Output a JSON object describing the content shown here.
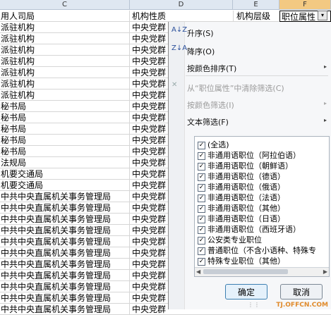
{
  "columns": [
    {
      "id": "C",
      "label": "C"
    },
    {
      "id": "D",
      "label": "D"
    },
    {
      "id": "E",
      "label": "E"
    },
    {
      "id": "F",
      "label": "F"
    }
  ],
  "header_row": {
    "c": "用人司局",
    "d": "机构性质",
    "e": "机构层级",
    "f": "职位属性",
    "dropdown_glyph": "▾"
  },
  "rows": [
    {
      "c": "派驻机构",
      "d": "中央党群"
    },
    {
      "c": "派驻机构",
      "d": "中央党群"
    },
    {
      "c": "派驻机构",
      "d": "中央党群"
    },
    {
      "c": "派驻机构",
      "d": "中央党群"
    },
    {
      "c": "派驻机构",
      "d": "中央党群"
    },
    {
      "c": "派驻机构",
      "d": "中央党群"
    },
    {
      "c": "派驻机构",
      "d": "中央党群"
    },
    {
      "c": "秘书局",
      "d": "中央党群"
    },
    {
      "c": "秘书局",
      "d": "中央党群"
    },
    {
      "c": "秘书局",
      "d": "中央党群"
    },
    {
      "c": "秘书局",
      "d": "中央党群"
    },
    {
      "c": "秘书局",
      "d": "中央党群"
    },
    {
      "c": "法规局",
      "d": "中央党群"
    },
    {
      "c": "机要交通局",
      "d": "中央党群"
    },
    {
      "c": "机要交通局",
      "d": "中央党群"
    },
    {
      "c": "中共中央直属机关事务管理局",
      "d": "中央党群"
    },
    {
      "c": "中共中央直属机关事务管理局",
      "d": "中央党群"
    },
    {
      "c": "中共中央直属机关事务管理局",
      "d": "中央党群"
    },
    {
      "c": "中共中央直属机关事务管理局",
      "d": "中央党群"
    },
    {
      "c": "中共中央直属机关事务管理局",
      "d": "中央党群"
    },
    {
      "c": "中共中央直属机关事务管理局",
      "d": "中央党群"
    },
    {
      "c": "中共中央直属机关事务管理局",
      "d": "中央党群"
    },
    {
      "c": "中共中央直属机关事务管理局",
      "d": "中央党群"
    },
    {
      "c": "中共中央直属机关事务管理局",
      "d": "中央党群"
    },
    {
      "c": "中共中央直属机关事务管理局",
      "d": "中央党群"
    },
    {
      "c": "中共中央直属机关事务管理局",
      "d": "中央党群"
    }
  ],
  "menu": {
    "sort_asc": "升序(S)",
    "sort_desc": "降序(O)",
    "sort_by_color": "按颜色排序(T)",
    "clear_filter": "从“职位属性”中清除筛选(C)",
    "filter_by_color": "按颜色筛选(I)",
    "text_filter": "文本筛选(F)",
    "sort_asc_icon": "A↓Z",
    "sort_desc_icon": "Z↓A",
    "clear_icon": "✕",
    "submenu_arrow": "▸",
    "options": [
      {
        "label": "(全选)",
        "checked": true
      },
      {
        "label": "非通用语职位（阿拉伯语）",
        "checked": true
      },
      {
        "label": "非通用语职位（朝鲜语）",
        "checked": true
      },
      {
        "label": "非通用语职位（德语）",
        "checked": true
      },
      {
        "label": "非通用语职位（俄语）",
        "checked": true
      },
      {
        "label": "非通用语职位（法语）",
        "checked": true
      },
      {
        "label": "非通用语职位（其他）",
        "checked": true
      },
      {
        "label": "非通用语职位（日语）",
        "checked": true
      },
      {
        "label": "非通用语职位（西班牙语）",
        "checked": true
      },
      {
        "label": "公安类专业职位",
        "checked": true
      },
      {
        "label": "普通职位（不含小语种、特殊专",
        "checked": true
      },
      {
        "label": "特殊专业职位（其他）",
        "checked": true
      }
    ],
    "ok_label": "确定",
    "cancel_label": "取消"
  },
  "watermark": "TJ.OFFCN.COM"
}
